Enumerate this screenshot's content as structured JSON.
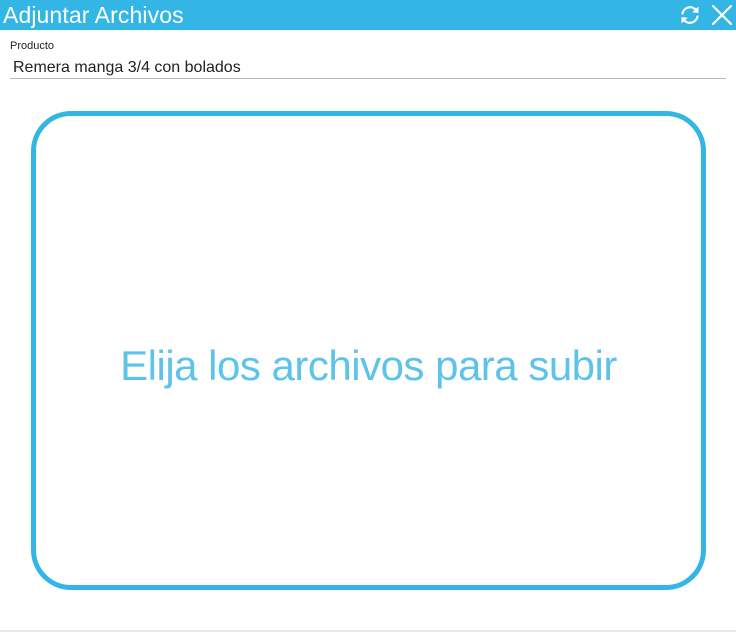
{
  "window": {
    "title": "Adjuntar Archivos",
    "accent_color": "#33b5e5",
    "buttons": {
      "refresh_icon": "refresh-icon",
      "close_icon": "close-icon"
    }
  },
  "form": {
    "product_label": "Producto",
    "product_value": "Remera manga 3/4 con bolados"
  },
  "upload": {
    "prompt": "Elija los archivos para subir"
  }
}
